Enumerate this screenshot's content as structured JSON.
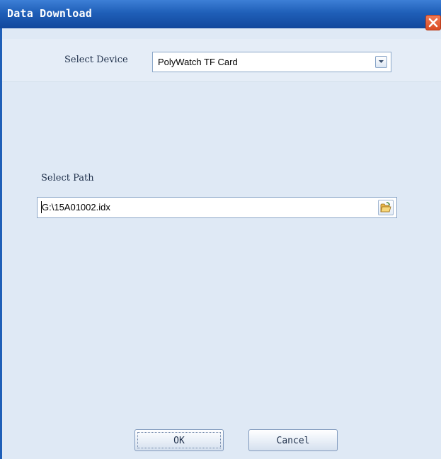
{
  "window": {
    "title": "Data Download"
  },
  "device": {
    "label": "Select Device",
    "selected": "PolyWatch TF Card"
  },
  "path": {
    "label": "Select Path",
    "value": "G:\\15A01002.idx"
  },
  "buttons": {
    "ok": "OK",
    "cancel": "Cancel"
  },
  "icons": {
    "close": "close-icon",
    "dropdown": "chevron-down-icon",
    "browse": "folder-open-icon"
  },
  "colors": {
    "titlebar": "#1f5fb8",
    "body": "#dfe9f5",
    "close": "#d94b23"
  }
}
